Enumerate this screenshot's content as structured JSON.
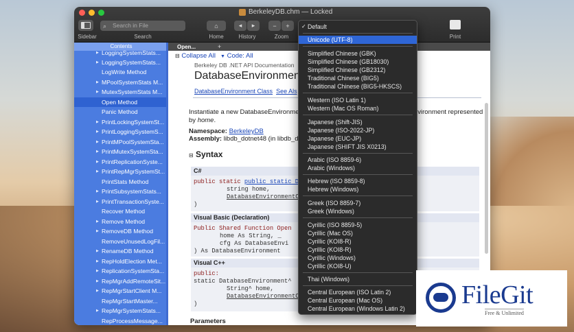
{
  "window": {
    "title": "BerkeleyDB.chm — Locked",
    "toolbar": {
      "sidebar_label": "Sidebar",
      "search_placeholder": "Search in File",
      "search_label": "Search",
      "home_label": "Home",
      "history_label": "History",
      "zoom_label": "Zoom",
      "print_label": "Print"
    }
  },
  "sidebar": {
    "tab_label": "Contents",
    "items": [
      {
        "label": "LoggingSystemStats..."
      },
      {
        "label": "LogWrite Method"
      },
      {
        "label": "MPoolSystemStats M..."
      },
      {
        "label": "MutexSystemStats M..."
      },
      {
        "label": "Open Method"
      },
      {
        "label": "Panic Method"
      },
      {
        "label": "PrintLockingSystemSt..."
      },
      {
        "label": "PrintLoggingSystemS..."
      },
      {
        "label": "PrintMPoolSystemSta..."
      },
      {
        "label": "PrintMutexSystemSta..."
      },
      {
        "label": "PrintReplicationSyste..."
      },
      {
        "label": "PrintRepMgrSystemSt..."
      },
      {
        "label": "PrintStats Method"
      },
      {
        "label": "PrintSubsystemStats..."
      },
      {
        "label": "PrintTransactionSyste..."
      },
      {
        "label": "Recover Method"
      },
      {
        "label": "Remove Method"
      },
      {
        "label": "RemoveDB Method"
      },
      {
        "label": "RemoveUnusedLogFil..."
      },
      {
        "label": "RenameDB Method"
      },
      {
        "label": "RepHoldElection Met..."
      },
      {
        "label": "ReplicationSystemSta..."
      },
      {
        "label": "RepMgrAddRemoteSit..."
      },
      {
        "label": "RepMgrStartClient M..."
      },
      {
        "label": "RepMgrStartMaster..."
      },
      {
        "label": "RepMgrSystemStats..."
      },
      {
        "label": "RepProcessMessage..."
      }
    ]
  },
  "content": {
    "tab_label": "Open...",
    "collapse_all": "Collapse All",
    "code_label": "Code: All",
    "breadcrumb": "Berkeley DB .NET API Documentation",
    "heading": "DatabaseEnvironment.Op",
    "link_class": "DatabaseEnvironment Class",
    "link_see_also": "See Als",
    "desc_start": "Instantiate a new DatabaseEnvironme",
    "desc_end": "nvironment represented",
    "desc_by": "by",
    "desc_home": "home",
    "desc_period": ".",
    "namespace_label": "Namespace:",
    "namespace_value": "BerkeleyDB",
    "assembly_label": "Assembly:",
    "assembly_value": "libdb_dotnet48 (in libdb_d",
    "syntax_heading": "Syntax",
    "csharp_label": "C#",
    "vb_label": "Visual Basic (Declaration)",
    "cpp_label": "Visual C++",
    "parameters_heading": "Parameters",
    "code_cs_1": "public static DatabaseEnvir",
    "code_cs_2": "string home,",
    "code_cs_3": "DatabaseEnvironmentC",
    "code_cs_4": ")",
    "code_vb_1": "Public Shared Function Open",
    "code_vb_2": "home As String, _",
    "code_vb_3": "cfg As DatabaseEnvi",
    "code_vb_4": ") As DatabaseEnvironment",
    "code_cpp_1": "public:",
    "code_cpp_2": "static DatabaseEnvironment^",
    "code_cpp_3": "String^ home,",
    "code_cpp_4": "DatabaseEnvironmentC",
    "code_cpp_5": ")"
  },
  "encoding_menu": {
    "items": [
      {
        "label": "Default",
        "checked": true
      },
      {
        "label": "Unicode  (UTF-8)",
        "highlighted": true
      },
      {
        "label": "Simplified Chinese  (GBK)"
      },
      {
        "label": "Simplified Chinese  (GB18030)"
      },
      {
        "label": "Simplified Chinese  (GB2312)"
      },
      {
        "label": "Traditional Chinese  (BIG5)"
      },
      {
        "label": "Traditional Chinese  (BIG5-HKSCS)"
      },
      {
        "label": "Western  (ISO Latin 1)"
      },
      {
        "label": "Western  (Mac OS Roman)"
      },
      {
        "label": "Japanese  (Shift-JIS)"
      },
      {
        "label": "Japanese  (ISO-2022-JP)"
      },
      {
        "label": "Japanese  (EUC-JP)"
      },
      {
        "label": "Japanese  (SHIFT JIS X0213)"
      },
      {
        "label": "Arabic  (ISO 8859-6)"
      },
      {
        "label": "Arabic  (Windows)"
      },
      {
        "label": "Hebrew  (ISO 8859-8)"
      },
      {
        "label": "Hebrew  (Windows)"
      },
      {
        "label": "Greek  (ISO 8859-7)"
      },
      {
        "label": "Greek  (Windows)"
      },
      {
        "label": "Cyrillic  (ISO 8859-5)"
      },
      {
        "label": "Cyrillic  (Mac OS)"
      },
      {
        "label": "Cyrillic  (KOI8-R)"
      },
      {
        "label": "Cyrillic  (KOI8-R)"
      },
      {
        "label": "Cyrillic  (Windows)"
      },
      {
        "label": "Cyrillic  (KOI8-U)"
      },
      {
        "label": "Thai  (Windows)"
      },
      {
        "label": "Central European  (ISO Latin 2)"
      },
      {
        "label": "Central European  (Mac OS)"
      },
      {
        "label": "Central European  (Windows Latin 2)"
      }
    ]
  },
  "watermark": {
    "name": "FileGit",
    "tagline": "Free & Unlimited"
  }
}
